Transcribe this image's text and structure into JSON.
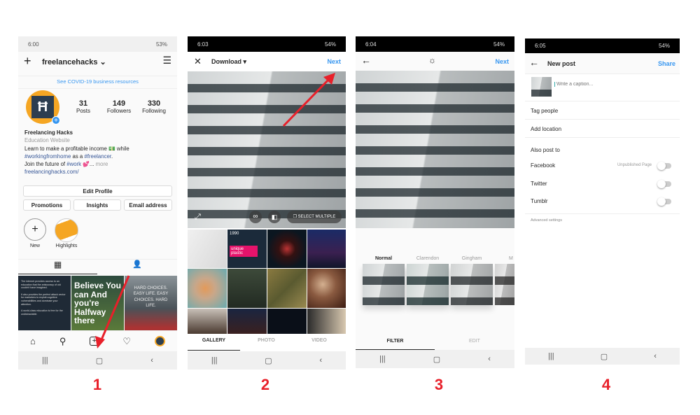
{
  "colors": {
    "accent": "#3897f0",
    "arrow": "#e8202a",
    "step": "#e8202a"
  },
  "steps": [
    "1",
    "2",
    "3",
    "4"
  ],
  "panel1": {
    "status": {
      "time": "6:00",
      "battery": "53%"
    },
    "header": {
      "new_icon": "plus-icon",
      "username": "freelancehacks",
      "menu_icon": "hamburger-icon"
    },
    "covid_link": "See COVID-19 business resources",
    "stats": [
      {
        "value": "31",
        "label": "Posts"
      },
      {
        "value": "149",
        "label": "Followers"
      },
      {
        "value": "330",
        "label": "Following"
      }
    ],
    "bio": {
      "name": "Freelancing Hacks",
      "category": "Education Website",
      "line1": "Learn to make a profitable income 💵 while",
      "line2a": "#workingfromhome",
      "line2b": " as a ",
      "line2c": "#freelancer",
      "line2d": ".",
      "line3a": "Join the future of ",
      "line3b": "#work",
      "line3c": " 💕... ",
      "more": "more",
      "link": "freelancinghacks.com/"
    },
    "buttons": {
      "edit": "Edit Profile",
      "promotions": "Promotions",
      "insights": "Insights",
      "email": "Email address"
    },
    "highlights": [
      {
        "label": "New"
      },
      {
        "label": "Highlights"
      }
    ],
    "posts": [
      {
        "text": "The internet provides access to an education that the aristocracy of old couldn't have imagined.\n\nIt also provides the perfect attack vector for marketers to exploit cognitive vulnerabilities and dominate your attention.\n\nA world-class education is free for the undistractable."
      },
      {
        "text": "Believe You can And you're Halfway there"
      },
      {
        "text": "HARD CHOICES. EASY LIFE. EASY CHOICES. HARD LIFE."
      }
    ],
    "bottom_nav": [
      "home-icon",
      "search-icon",
      "add-post-icon",
      "heart-icon",
      "profile-avatar"
    ]
  },
  "panel2": {
    "status": {
      "time": "6:03",
      "battery": "54%"
    },
    "header": {
      "source": "Download",
      "next": "Next"
    },
    "overlay": {
      "select_multiple": "SELECT MULTIPLE"
    },
    "gallery_tile_text": {
      "year": "1990",
      "title": "unique plastic"
    },
    "tabs": [
      "GALLERY",
      "PHOTO",
      "VIDEO"
    ],
    "active_tab": "GALLERY"
  },
  "panel3": {
    "status": {
      "time": "6:04",
      "battery": "54%"
    },
    "header": {
      "next": "Next"
    },
    "filters": [
      "Normal",
      "Clarendon",
      "Gingham",
      "M"
    ],
    "selected_filter": "Normal",
    "tabs": [
      "FILTER",
      "EDIT"
    ],
    "active_tab": "FILTER"
  },
  "panel4": {
    "status": {
      "time": "6:05",
      "battery": "54%"
    },
    "header": {
      "title": "New post",
      "share": "Share"
    },
    "caption_placeholder": "Write a caption...",
    "tag_people": "Tag people",
    "add_location": "Add location",
    "also_post_to": "Also post to",
    "networks": [
      {
        "name": "Facebook",
        "note": "Unpublished Page",
        "on": false
      },
      {
        "name": "Twitter",
        "note": "",
        "on": false
      },
      {
        "name": "Tumblr",
        "note": "",
        "on": false
      }
    ],
    "advanced": "Advanced settings"
  }
}
